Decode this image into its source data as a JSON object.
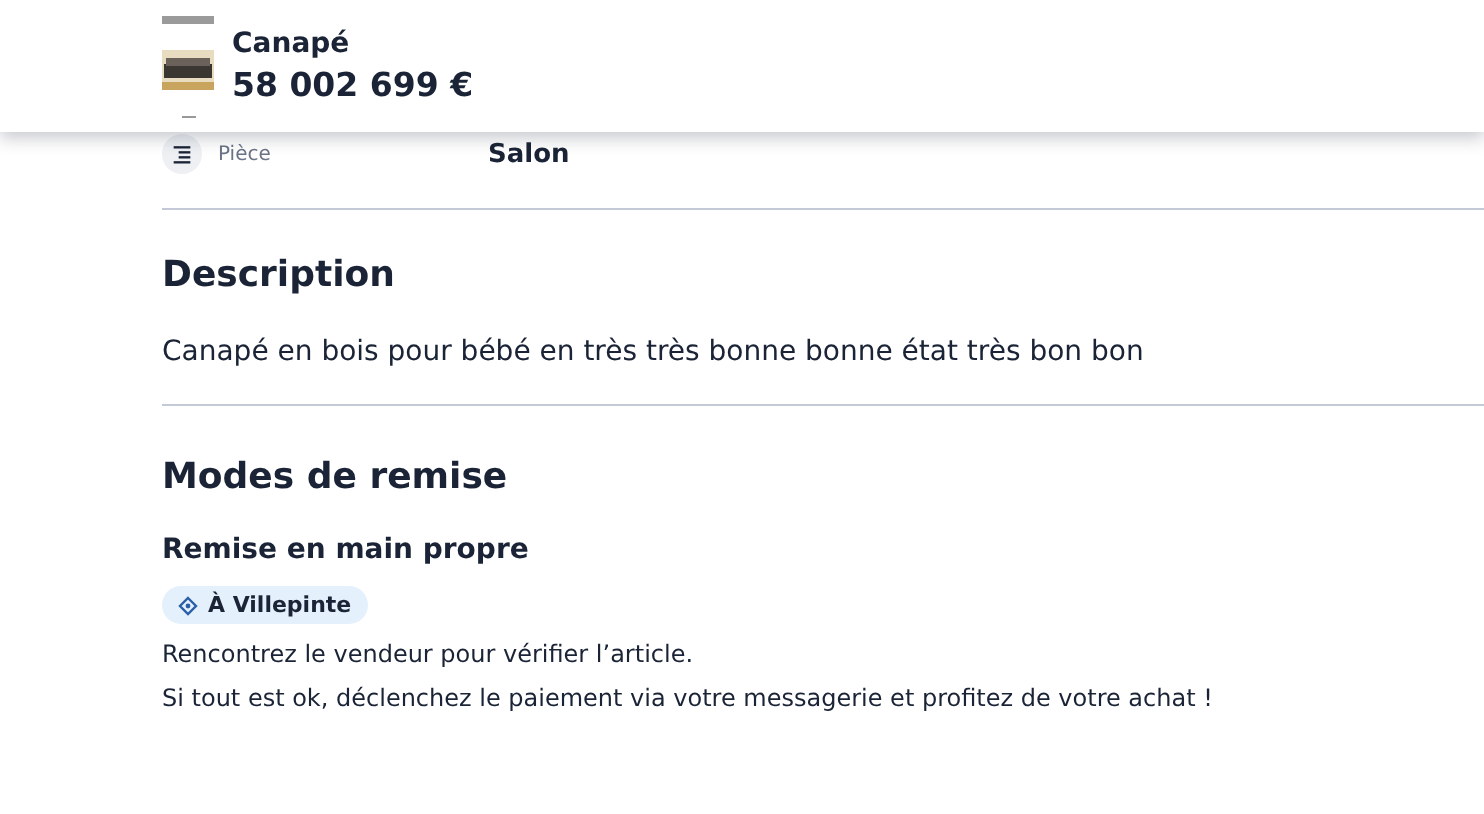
{
  "header": {
    "title": "Canapé",
    "price": "58 002 699 €"
  },
  "attribute": {
    "label": "Pièce",
    "value": "Salon"
  },
  "description": {
    "heading": "Description",
    "text": "Canapé en bois pour bébé en très très bonne bonne état très bon bon"
  },
  "delivery": {
    "heading": "Modes de remise",
    "method": "Remise en main propre",
    "location": "À Villepinte",
    "lines": [
      "Rencontrez le vendeur pour vérifier l’article.",
      "Si tout est ok, déclenchez le paiement via votre messagerie et profitez de votre achat !"
    ]
  }
}
